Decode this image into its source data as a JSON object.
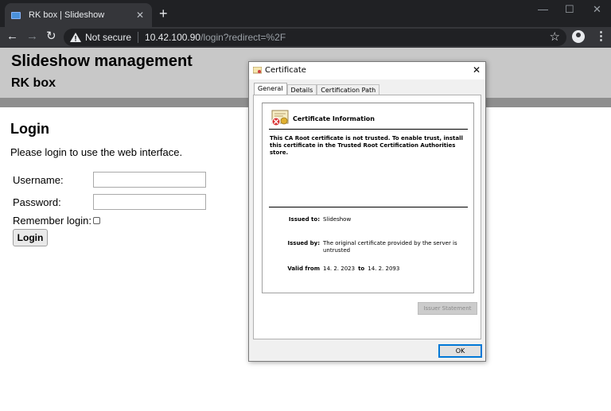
{
  "browser": {
    "tab_title": "RK box | Slideshow",
    "tab_close": "✕",
    "new_tab": "+",
    "minimize": "—",
    "maximize": "☐",
    "close": "✕",
    "back": "←",
    "forward": "→",
    "reload": "↻",
    "security_label": "Not secure",
    "url_host": "10.42.100.90",
    "url_path": "/login?redirect=%2F",
    "bookmark": "☆",
    "menu": "⋮"
  },
  "page": {
    "title": "Slideshow management",
    "subtitle": "RK box",
    "login_heading": "Login",
    "login_description": "Please login to use the web interface.",
    "username_label": "Username:",
    "password_label": "Password:",
    "remember_label": "Remember login:",
    "remember_checked": false,
    "login_button": "Login",
    "username_value": "",
    "password_value": ""
  },
  "dialog": {
    "title": "Certificate",
    "close": "✕",
    "tabs": [
      {
        "label": "General",
        "active": true
      },
      {
        "label": "Details",
        "active": false
      },
      {
        "label": "Certification Path",
        "active": false
      }
    ],
    "info_title": "Certificate Information",
    "warning": "This CA Root certificate is not trusted. To enable trust, install this certificate in the Trusted Root Certification Authorities store.",
    "issued_to_label": "Issued to:",
    "issued_to_value": "Slideshow",
    "issued_by_label": "Issued by:",
    "issued_by_value": "The original certificate provided by the server is untrusted",
    "valid_from_label": "Valid from",
    "valid_from_value": "14. 2. 2023",
    "valid_to_label": "to",
    "valid_to_value": "14. 2. 2093",
    "issuer_statement_button": "Issuer Statement",
    "ok_button": "OK"
  },
  "colors": {
    "chrome_dark": "#202124",
    "chrome_toolbar": "#35363a",
    "page_header": "#c8c8c8",
    "header_bar": "#8e8e8e",
    "focus_blue": "#0078d7"
  }
}
